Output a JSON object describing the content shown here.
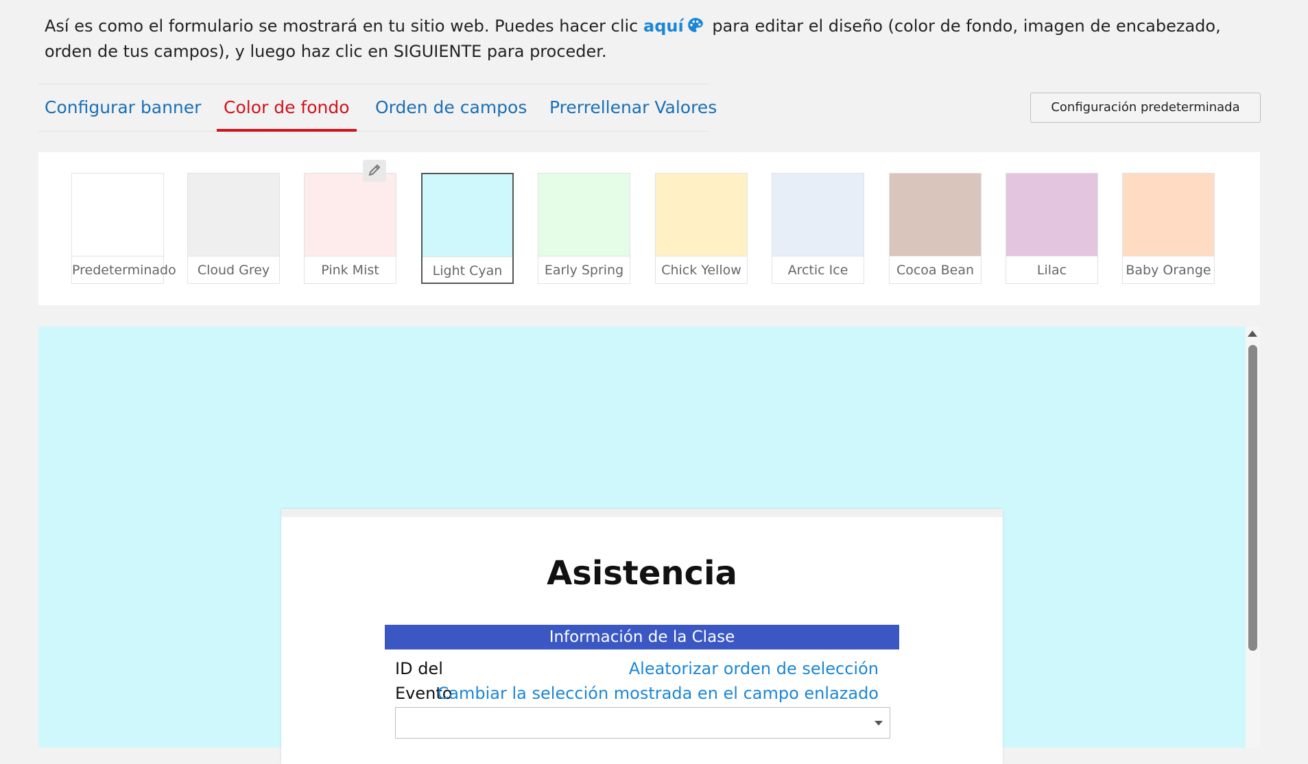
{
  "intro": {
    "text_before": "Así es como el formulario se mostrará en tu sitio web. Puedes hacer clic ",
    "link": "aquí",
    "text_after": " para editar el diseño (color de fondo, imagen de encabezado, orden de tus campos), y luego haz clic en SIGUIENTE para proceder."
  },
  "tabs": [
    {
      "label": "Configurar banner"
    },
    {
      "label": "Color de fondo"
    },
    {
      "label": "Orden de campos"
    },
    {
      "label": "Prerrellenar Valores"
    }
  ],
  "active_tab": "Color de fondo",
  "default_button": "Configuración predeterminada",
  "swatches": [
    {
      "label": "Predeterminado",
      "color": "#ffffff"
    },
    {
      "label": "Cloud Grey",
      "color": "#efefef"
    },
    {
      "label": "Pink Mist",
      "color": "#fdeceb"
    },
    {
      "label": "Light Cyan",
      "color": "#cff8fd"
    },
    {
      "label": "Early Spring",
      "color": "#e5fde7"
    },
    {
      "label": "Chick Yellow",
      "color": "#fff0c6"
    },
    {
      "label": "Arctic Ice",
      "color": "#e8eef8"
    },
    {
      "label": "Cocoa Bean",
      "color": "#d9c5bc"
    },
    {
      "label": "Lilac",
      "color": "#e3c5e0"
    },
    {
      "label": "Baby Orange",
      "color": "#ffdbc4"
    }
  ],
  "selected_swatch": "Light Cyan",
  "form": {
    "title": "Asistencia",
    "section": "Información de la Clase",
    "field_label_line1": "ID del",
    "field_label_line2": "Evento",
    "link_randomize": "Aleatorizar orden de selección",
    "link_change": "Cambiar la selección mostrada en el campo enlazado",
    "select_value": ""
  },
  "colors": {
    "link": "#1a86d6",
    "tab_link": "#1a6fb5",
    "tab_active": "#d0121c",
    "preview_bg": "#cff8fd",
    "section_bar": "#3a57c4"
  }
}
